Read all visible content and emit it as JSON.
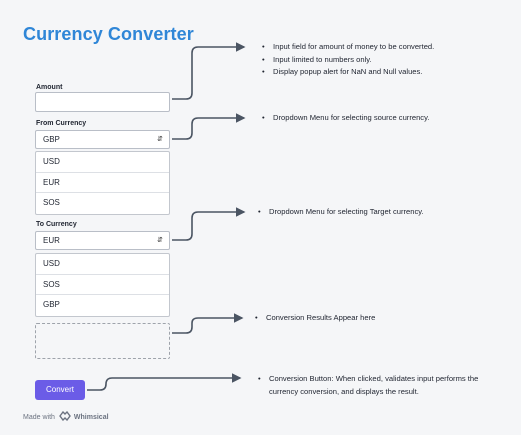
{
  "title": "Currency Converter",
  "amount": {
    "label": "Amount",
    "value": ""
  },
  "from_currency": {
    "label": "From Currency",
    "selected": "GBP",
    "options": [
      "USD",
      "EUR",
      "SOS"
    ]
  },
  "to_currency": {
    "label": "To Currency",
    "selected": "EUR",
    "options": [
      "USD",
      "SOS",
      "GBP"
    ]
  },
  "convert_button": {
    "label": "Convert"
  },
  "notes": {
    "amount": [
      "Input field for amount of money to be converted.",
      "Input limited to numbers only.",
      "Display popup alert for NaN and Null values."
    ],
    "from": [
      "Dropdown Menu for selecting source currency."
    ],
    "to": [
      "Dropdown Menu for selecting Target currency."
    ],
    "result": [
      "Conversion Results Appear here"
    ],
    "convert": [
      "Conversion Button: When clicked, validates input performs the currency conversion, and displays the result."
    ]
  },
  "footer": {
    "prefix": "Made with",
    "brand": "Whimsical"
  },
  "colors": {
    "title": "#2f86d7",
    "button": "#6b5ce7",
    "connector": "#4b5563"
  },
  "icons": {
    "caret": "caret-icon",
    "logo": "whimsical-logo-icon"
  }
}
